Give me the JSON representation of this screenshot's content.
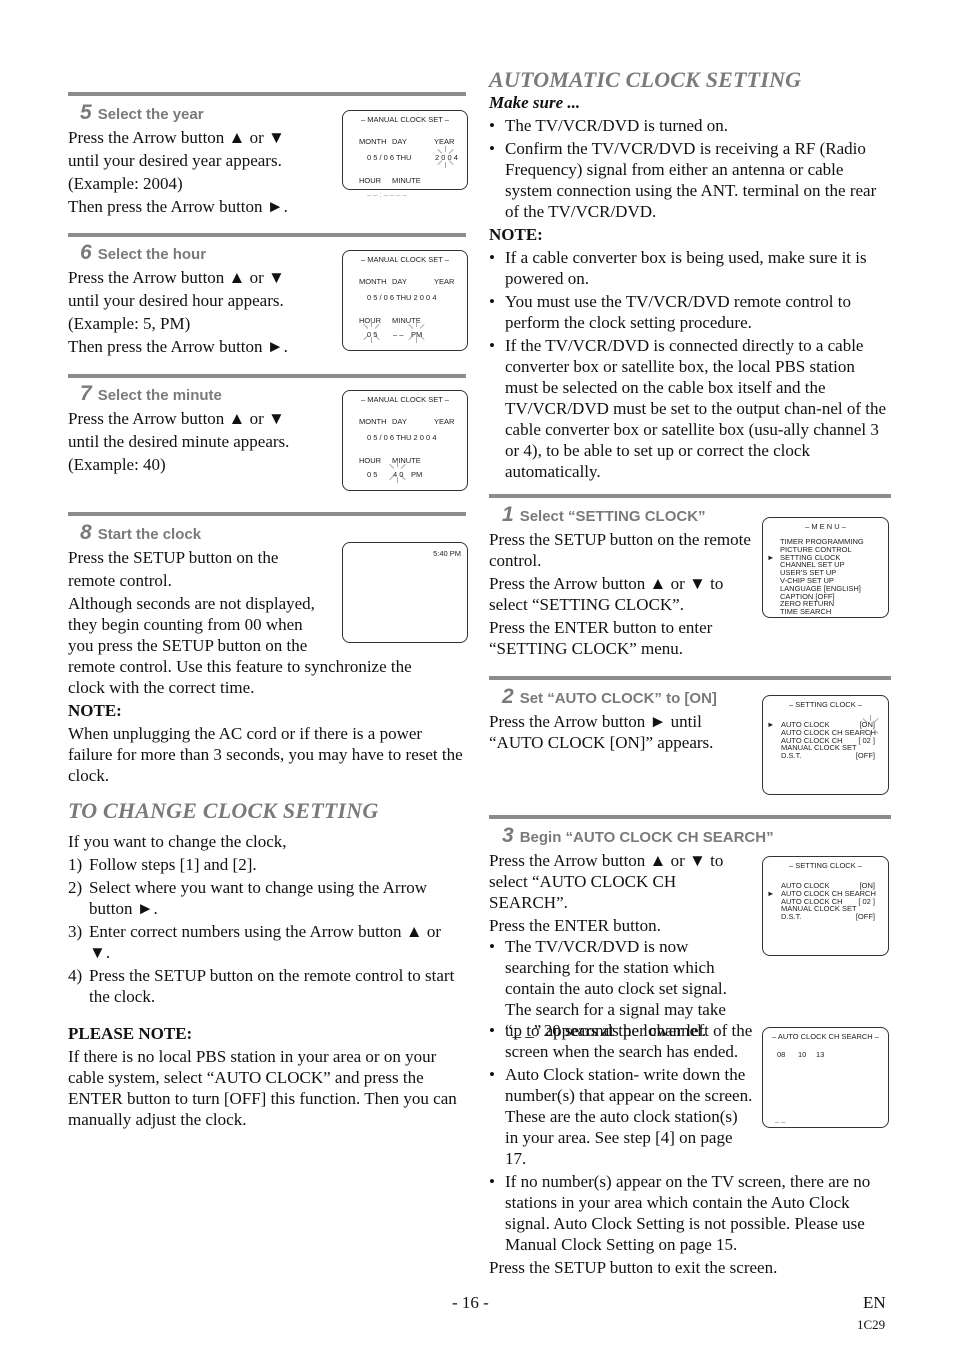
{
  "left": {
    "steps": [
      {
        "number": "5",
        "title": "Select the year",
        "lines": [
          "Press the Arrow button ▲ or ▼",
          "until your desired year appears.",
          "(Example: 2004)",
          "Then press the Arrow button ►."
        ],
        "screen": {
          "title": "– MANUAL CLOCK SET –",
          "labels_row1": [
            "MONTH",
            "DAY",
            "YEAR"
          ],
          "date_value": "0 5  /  0 6   THU",
          "year_value": "2 0 0 4",
          "labels_row2": [
            "HOUR",
            "MINUTE"
          ],
          "time_value": "– –  :  – –   – –"
        }
      },
      {
        "number": "6",
        "title": "Select the hour",
        "lines": [
          "Press the Arrow button ▲ or ▼",
          "until your desired hour appears.",
          "(Example: 5, PM)",
          "Then press the Arrow button ►."
        ],
        "screen": {
          "title": "– MANUAL CLOCK SET –",
          "labels_row1": [
            "MONTH",
            "DAY",
            "YEAR"
          ],
          "date_value": "0 5  /  0 6   THU   2 0 0 4",
          "labels_row2": [
            "HOUR",
            "MINUTE"
          ],
          "hour_value": "0 5",
          "minute_value": "– –",
          "ampm_value": "PM"
        }
      },
      {
        "number": "7",
        "title": "Select the minute",
        "lines": [
          "Press the Arrow button ▲ or ▼",
          "until the desired minute appears.",
          "(Example: 40)"
        ],
        "screen": {
          "title": "– MANUAL CLOCK SET –",
          "labels_row1": [
            "MONTH",
            "DAY",
            "YEAR"
          ],
          "date_value": "0 5  /  0 6   THU   2 0 0 4",
          "labels_row2": [
            "HOUR",
            "MINUTE"
          ],
          "hour_value": "0 5",
          "minute_value": "4 0",
          "ampm_value": "PM"
        }
      },
      {
        "number": "8",
        "title": "Start the clock",
        "lines_narrow": [
          "Press the SETUP button on the",
          "remote control.",
          "Although seconds are not displayed,",
          "they begin counting from 00 when",
          "you press the SETUP button on the"
        ],
        "lines_wide": [
          "remote control. Use this feature to synchronize the",
          "clock with the correct time."
        ],
        "note_label": "NOTE:",
        "note_text": "When unplugging the AC cord or if there is a power failure for more than 3 seconds, you may have to reset the clock.",
        "screen": {
          "clock": "5:40 PM"
        }
      }
    ],
    "change_section": {
      "title": "TO CHANGE CLOCK SETTING",
      "intro": "If you want to change the clock,",
      "items": [
        {
          "n": "1)",
          "text": "Follow steps [1] and [2]."
        },
        {
          "n": "2)",
          "text": "Select where you want to change using the Arrow button ►."
        },
        {
          "n": "3)",
          "text": "Enter correct numbers using the Arrow button ▲ or ▼."
        },
        {
          "n": "4)",
          "text": "Press the SETUP button on the remote control to start the clock."
        }
      ],
      "please_note_label": "PLEASE NOTE:",
      "please_note_text": "If there is no local PBS station in your area or on your cable system, select “AUTO CLOCK” and press the ENTER button to turn [OFF] this function. Then you can manually adjust the clock."
    }
  },
  "right": {
    "title": "AUTOMATIC CLOCK SETTING",
    "make_sure_label": "Make sure ...",
    "make_sure_items": [
      "The TV/VCR/DVD is turned on.",
      "Confirm the TV/VCR/DVD is receiving a RF (Radio Frequency) signal from either an antenna or cable system connection using the ANT. terminal on the rear of the TV/VCR/DVD."
    ],
    "note_label": "NOTE:",
    "note_items": [
      "If a cable converter box is being used, make sure it is powered on.",
      "You must use the TV/VCR/DVD remote control to perform the clock setting procedure.",
      "If the TV/VCR/DVD is connected directly to a cable converter box or satellite box, the local PBS station must be selected on the cable box itself and the TV/VCR/DVD must be set to the output chan-nel of the cable converter box or satellite box (usu-ally channel 3 or 4), to be able to set up or correct the clock automatically."
    ],
    "steps": [
      {
        "number": "1",
        "title": "Select “SETTING CLOCK”",
        "paragraphs": [
          "Press the SETUP button on the remote control.",
          "Press the Arrow button ▲ or ▼ to select “SETTING CLOCK”.",
          "Press the ENTER button to enter “SETTING CLOCK” menu."
        ],
        "screen": {
          "title": "– M E N U –",
          "items": [
            "TIMER PROGRAMMING",
            "PICTURE CONTROL",
            "SETTING CLOCK",
            "CHANNEL SET UP",
            "USER'S SET UP",
            "V-CHIP SET UP",
            "LANGUAGE  [ENGLISH]",
            "CAPTION  [OFF]",
            "ZERO RETURN",
            "TIME SEARCH"
          ],
          "selected_index": 2
        }
      },
      {
        "number": "2",
        "title": "Set “AUTO CLOCK” to [ON]",
        "paragraphs": [
          "Press the Arrow button ► until “AUTO CLOCK [ON]” appears."
        ],
        "screen": {
          "title": "– SETTING CLOCK –",
          "items": [
            {
              "label": "AUTO CLOCK",
              "value": "[ON]"
            },
            {
              "label": "AUTO CLOCK CH SEARCH",
              "value": ""
            },
            {
              "label": "AUTO CLOCK CH",
              "value": "[ 02 ]"
            },
            {
              "label": "MANUAL CLOCK SET",
              "value": ""
            },
            {
              "label": "D.S.T.",
              "value": "[OFF]"
            }
          ],
          "selected_index": 0
        }
      },
      {
        "number": "3",
        "title": "Begin “AUTO CLOCK CH SEARCH”",
        "paragraphs": [
          "Press the Arrow button ▲ or ▼ to select “AUTO CLOCK CH SEARCH”.",
          "Press the ENTER button."
        ],
        "bullets": [
          "The TV/VCR/DVD is now searching for the station which contain the auto clock set signal. The search for a signal may take up to 20 seconds per channel.",
          "“_ _” appears at the lower left of the screen when the search has ended.",
          "Auto Clock station- write down the number(s) that appear on the screen. These are the auto clock station(s) in your area. See step [4] on page 17.",
          "If no number(s) appear on the TV screen, there are no stations in your area which contain the Auto Clock signal. Auto Clock Setting is not possible. Please use Manual Clock Setting on page 15."
        ],
        "closing": "Press the SETUP button to exit the screen.",
        "screen": {
          "title": "– SETTING CLOCK –",
          "items": [
            {
              "label": "AUTO CLOCK",
              "value": "[ON]"
            },
            {
              "label": "AUTO CLOCK CH SEARCH",
              "value": ""
            },
            {
              "label": "AUTO CLOCK CH",
              "value": "[ 02 ]"
            },
            {
              "label": "MANUAL CLOCK SET",
              "value": ""
            },
            {
              "label": "D.S.T.",
              "value": "[OFF]"
            }
          ],
          "selected_index": 1
        },
        "search_screen": {
          "title": "– AUTO CLOCK CH SEARCH –",
          "channels": [
            "08",
            "10",
            "13"
          ],
          "end_marker": "– –"
        }
      }
    ]
  },
  "footer": {
    "page": "- 16 -",
    "lang": "EN",
    "code": "1C29"
  },
  "colors": {
    "heading_gray": "#7a7a7a",
    "rule_gray": "#8c8c8c",
    "text": "#111111"
  }
}
